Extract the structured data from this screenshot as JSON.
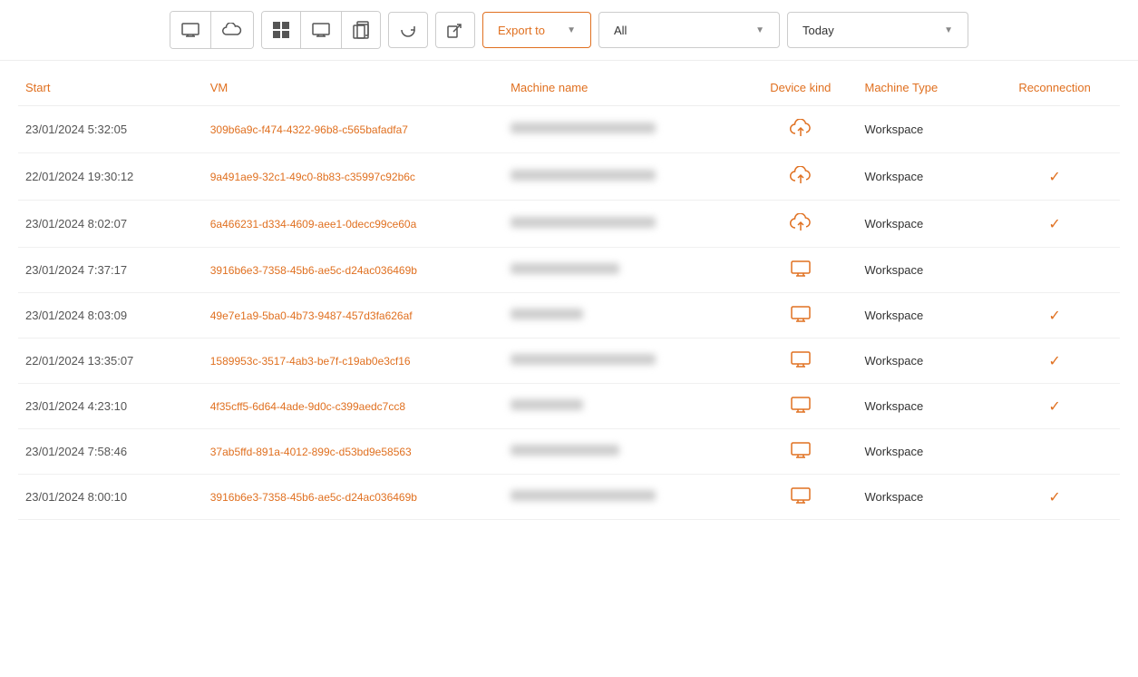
{
  "toolbar": {
    "groups": [
      {
        "id": "view-group",
        "buttons": [
          {
            "id": "monitor-btn",
            "icon": "monitor",
            "label": "Monitor"
          },
          {
            "id": "cloud-btn",
            "icon": "cloud",
            "label": "Cloud"
          }
        ]
      },
      {
        "id": "os-group",
        "buttons": [
          {
            "id": "windows-btn",
            "icon": "windows",
            "label": "Windows"
          },
          {
            "id": "monitor2-btn",
            "icon": "monitor2",
            "label": "Monitor2"
          },
          {
            "id": "copy-btn",
            "icon": "copy",
            "label": "Copy"
          }
        ]
      }
    ],
    "single_buttons": [
      {
        "id": "refresh-btn",
        "icon": "refresh",
        "label": "Refresh"
      },
      {
        "id": "link-btn",
        "icon": "link",
        "label": "Link"
      }
    ],
    "export_label": "Export to",
    "all_label": "All",
    "today_label": "Today"
  },
  "table": {
    "columns": [
      {
        "id": "start",
        "label": "Start"
      },
      {
        "id": "vm",
        "label": "VM"
      },
      {
        "id": "machine_name",
        "label": "Machine name"
      },
      {
        "id": "device_kind",
        "label": "Device kind"
      },
      {
        "id": "machine_type",
        "label": "Machine Type"
      },
      {
        "id": "reconnection",
        "label": "Reconnection"
      }
    ],
    "rows": [
      {
        "start": "23/01/2024 5:32:05",
        "vm": "309b6a9c-f474-4322-96b8-c565bafadfa7",
        "machine_name_blur": "long",
        "device_kind": "cloud",
        "machine_type": "Workspace",
        "reconnection": ""
      },
      {
        "start": "22/01/2024 19:30:12",
        "vm": "9a491ae9-32c1-49c0-8b83-c35997c92b6c",
        "machine_name_blur": "long",
        "device_kind": "cloud",
        "machine_type": "Workspace",
        "reconnection": "✓"
      },
      {
        "start": "23/01/2024 8:02:07",
        "vm": "6a466231-d334-4609-aee1-0decc99ce60a",
        "machine_name_blur": "long",
        "device_kind": "cloud",
        "machine_type": "Workspace",
        "reconnection": "✓"
      },
      {
        "start": "23/01/2024 7:37:17",
        "vm": "3916b6e3-7358-45b6-ae5c-d24ac036469b",
        "machine_name_blur": "medium",
        "device_kind": "monitor",
        "machine_type": "Workspace",
        "reconnection": ""
      },
      {
        "start": "23/01/2024 8:03:09",
        "vm": "49e7e1a9-5ba0-4b73-9487-457d3fa626af",
        "machine_name_blur": "short",
        "device_kind": "monitor",
        "machine_type": "Workspace",
        "reconnection": "✓"
      },
      {
        "start": "22/01/2024 13:35:07",
        "vm": "1589953c-3517-4ab3-be7f-c19ab0e3cf16",
        "machine_name_blur": "long",
        "device_kind": "monitor",
        "machine_type": "Workspace",
        "reconnection": "✓"
      },
      {
        "start": "23/01/2024 4:23:10",
        "vm": "4f35cff5-6d64-4ade-9d0c-c399aedc7cc8",
        "machine_name_blur": "short",
        "device_kind": "monitor",
        "machine_type": "Workspace",
        "reconnection": "✓"
      },
      {
        "start": "23/01/2024 7:58:46",
        "vm": "37ab5ffd-891a-4012-899c-d53bd9e58563",
        "machine_name_blur": "medium",
        "device_kind": "monitor",
        "machine_type": "Workspace",
        "reconnection": ""
      },
      {
        "start": "23/01/2024 8:00:10",
        "vm": "3916b6e3-7358-45b6-ae5c-d24ac036469b",
        "machine_name_blur": "long",
        "device_kind": "monitor",
        "machine_type": "Workspace",
        "reconnection": "✓"
      }
    ]
  },
  "colors": {
    "accent": "#e07020",
    "text_muted": "#888",
    "border": "#ccc"
  }
}
